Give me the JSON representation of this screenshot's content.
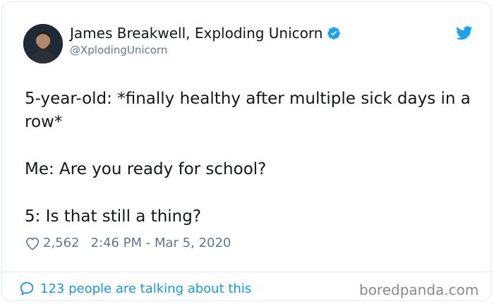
{
  "author": {
    "name": "James Breakwell, Exploding Unicorn",
    "handle": "@XplodingUnicorn",
    "verified": true,
    "avatar": "person-avatar"
  },
  "tweet": {
    "lines": [
      "5-year-old: *finally healthy after multiple sick days in a row*",
      "Me: Are you ready for school?",
      "5: Is that still a thing?"
    ],
    "likes": "2,562",
    "timestamp": "2:46 PM - Mar 5, 2020"
  },
  "footer": {
    "talking": "123 people are talking about this",
    "watermark": "boredpanda.com"
  },
  "icons": {
    "verified": "verified-badge-icon",
    "twitter": "twitter-bird-icon",
    "like": "heart-icon",
    "reply": "speech-bubble-icon"
  },
  "colors": {
    "accent": "#1da1f2",
    "link": "#1b95e0",
    "text": "#14171a",
    "muted": "#657786",
    "border": "#e1e8ed"
  }
}
